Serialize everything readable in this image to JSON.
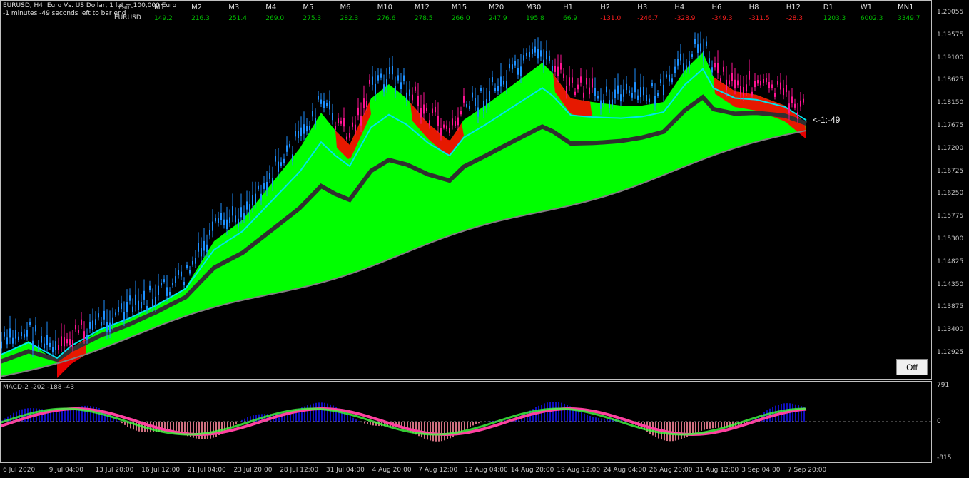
{
  "header": {
    "symbol_line": "EURUSD, H4:  Euro Vs. US Dollar, 1 lot = 100,000 Euro",
    "timer_line": "-1 minutes -49 seconds left to bar end",
    "pairs_label": "Pairs",
    "pair_name": "EURUSD"
  },
  "strength_table": {
    "columns": [
      "M1",
      "M2",
      "M3",
      "M4",
      "M5",
      "M6",
      "M10",
      "M12",
      "M15",
      "M20",
      "M30",
      "H1",
      "H2",
      "H3",
      "H4",
      "H6",
      "H8",
      "H12",
      "D1",
      "W1",
      "MN1"
    ],
    "values": [
      "149.2",
      "216.3",
      "251.4",
      "269.0",
      "275.3",
      "282.3",
      "276.6",
      "278.5",
      "266.0",
      "247.9",
      "195.8",
      "66.9",
      "-131.0",
      "-246.7",
      "-328.9",
      "-349.3",
      "-311.5",
      "-28.3",
      "1203.3",
      "6002.3",
      "3349.7"
    ],
    "positive_color": "#00c000",
    "negative_color": "#ff2020"
  },
  "price_axis": {
    "ticks": [
      "1.20055",
      "1.19575",
      "1.19100",
      "1.18625",
      "1.18150",
      "1.17675",
      "1.17200",
      "1.16725",
      "1.16250",
      "1.15775",
      "1.15300",
      "1.14825",
      "1.14350",
      "1.13875",
      "1.13400",
      "1.12925"
    ]
  },
  "countdown_label": "<-1:-49",
  "off_button": "Off",
  "macd": {
    "label": "MACD-2 -202 -188 -43",
    "axis_top": "791",
    "axis_zero": "0",
    "axis_bottom": "-815"
  },
  "time_axis": {
    "labels": [
      "6 Jul 2020",
      "9 Jul 04:00",
      "13 Jul 20:00",
      "16 Jul 12:00",
      "21 Jul 04:00",
      "23 Jul 20:00",
      "28 Jul 12:00",
      "31 Jul 04:00",
      "4 Aug 20:00",
      "7 Aug 12:00",
      "12 Aug 04:00",
      "14 Aug 20:00",
      "19 Aug 12:00",
      "24 Aug 04:00",
      "26 Aug 20:00",
      "31 Aug 12:00",
      "3 Sep 04:00",
      "7 Sep 20:00"
    ]
  },
  "colors": {
    "bull_cloud": "#00ff00",
    "bear_cloud": "#ff0000",
    "candle": "#1e90ff",
    "ema_fast": "#00e5ee",
    "ema_slow": "#303030",
    "macd_up": "#1010c0",
    "macd_down": "#ff40a0"
  }
}
